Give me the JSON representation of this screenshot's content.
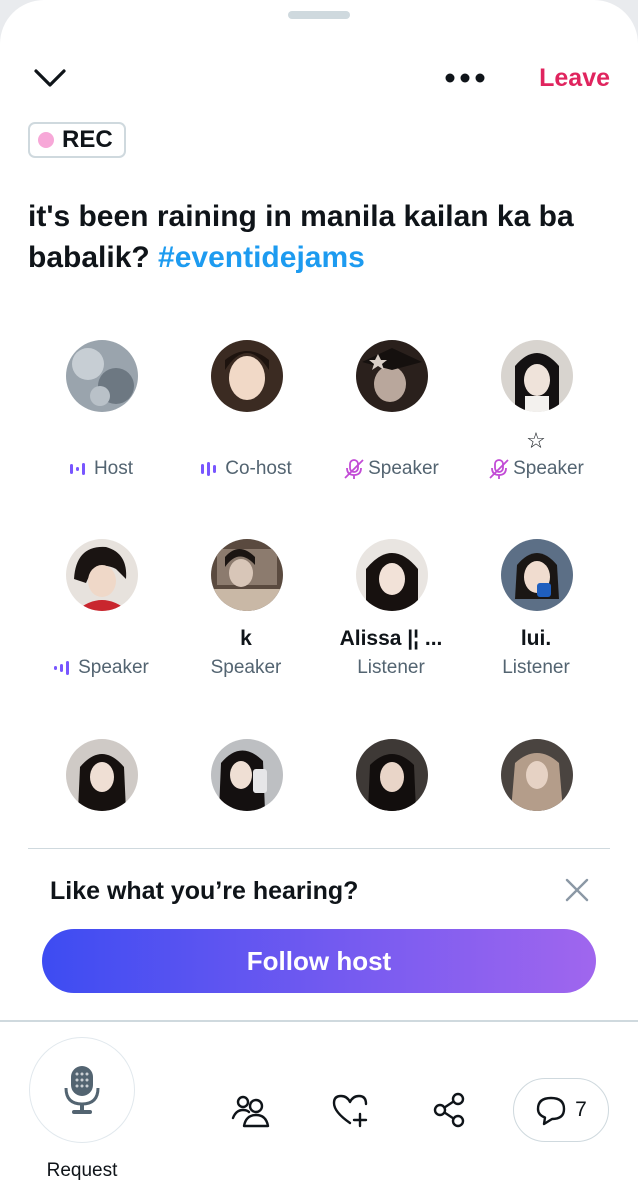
{
  "header": {
    "leave_label": "Leave",
    "rec_label": "REC"
  },
  "space": {
    "title_text": "it's been raining in manila kailan ka ba babalik? ",
    "hashtag": "#eventidejams"
  },
  "participants": [
    {
      "name": "",
      "role": "Host",
      "role_icon": "speaking-bars-icon"
    },
    {
      "name": "",
      "role": "Co-host",
      "role_icon": "speaking-bars-icon"
    },
    {
      "name": "",
      "role": "Speaker",
      "role_icon": "mic-muted-icon"
    },
    {
      "name": "☆",
      "role": "Speaker",
      "role_icon": "mic-muted-icon"
    },
    {
      "name": "",
      "role": "Speaker",
      "role_icon": "speaking-bars-icon"
    },
    {
      "name": "k",
      "role": "Speaker",
      "role_icon": ""
    },
    {
      "name": "Alissa |¦ ...",
      "role": "Listener",
      "role_icon": ""
    },
    {
      "name": "lui.",
      "role": "Listener",
      "role_icon": ""
    },
    {
      "name": "",
      "role": "",
      "role_icon": ""
    },
    {
      "name": "",
      "role": "",
      "role_icon": ""
    },
    {
      "name": "",
      "role": "",
      "role_icon": ""
    },
    {
      "name": "",
      "role": "",
      "role_icon": ""
    }
  ],
  "promo": {
    "title": "Like what you’re hearing?",
    "follow_label": "Follow host"
  },
  "bottom_bar": {
    "request_label": "Request",
    "chat_count": "7"
  },
  "colors": {
    "leave": "#e0245e",
    "hashtag": "#1d9bf0",
    "accent_purple": "#7856ff",
    "muted_pink": "#c24bd6",
    "rec_dot": "#f7a8d8"
  }
}
